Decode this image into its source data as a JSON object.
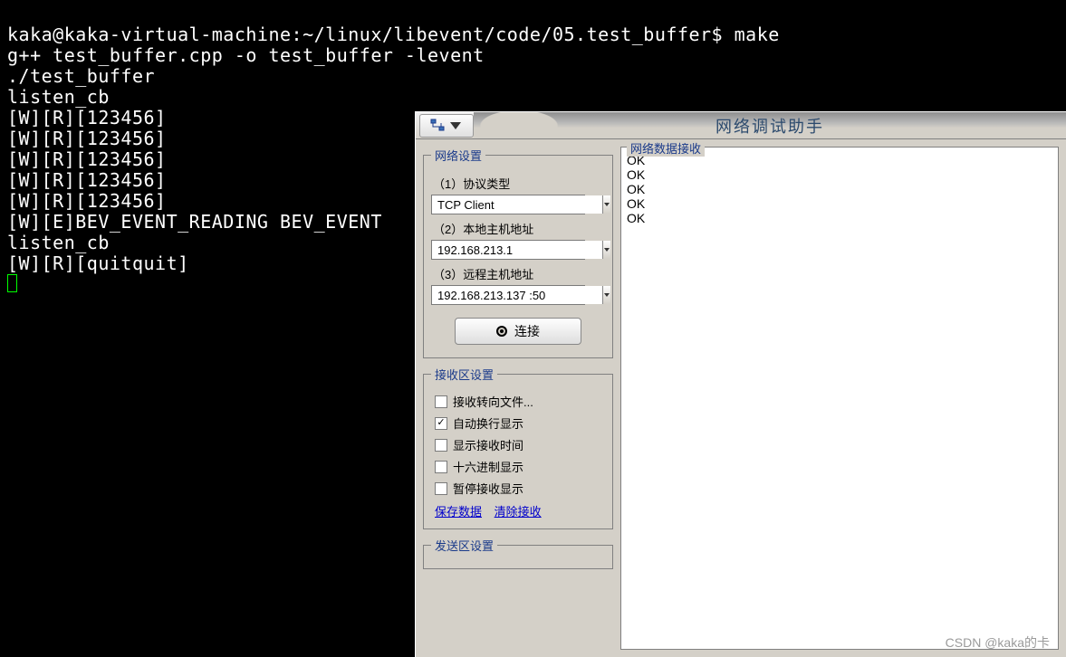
{
  "terminal": {
    "prompt": "kaka@kaka-virtual-machine:~/linux/libevent/code/05.test_buffer$ ",
    "cmd": "make",
    "lines": [
      "g++ test_buffer.cpp -o test_buffer -levent",
      "./test_buffer",
      "listen_cb",
      "[W][R][123456]",
      "[W][R][123456]",
      "[W][R][123456]",
      "[W][R][123456]",
      "[W][R][123456]",
      "[W][E]BEV_EVENT_READING BEV_EVENT",
      "listen_cb",
      "[W][R][quitquit]"
    ]
  },
  "app": {
    "title": "网络调试助手",
    "net_settings": {
      "legend": "网络设置",
      "proto_label": "（1）协议类型",
      "proto_value": "TCP Client",
      "local_label": "（2）本地主机地址",
      "local_value": "192.168.213.1",
      "remote_label": "（3）远程主机地址",
      "remote_value": "192.168.213.137 :50",
      "connect_label": "连接"
    },
    "recv_settings": {
      "legend": "接收区设置",
      "opts": {
        "to_file": {
          "label": "接收转向文件...",
          "checked": false
        },
        "auto_wrap": {
          "label": "自动换行显示",
          "checked": true
        },
        "show_time": {
          "label": "显示接收时间",
          "checked": false
        },
        "hex": {
          "label": "十六进制显示",
          "checked": false
        },
        "pause": {
          "label": "暂停接收显示",
          "checked": false
        }
      },
      "links": {
        "save": "保存数据",
        "clear": "清除接收"
      }
    },
    "send_settings": {
      "legend": "发送区设置"
    },
    "recv_panel": {
      "legend": "网络数据接收",
      "lines": [
        "OK",
        "OK",
        "OK",
        "OK",
        "OK"
      ]
    }
  },
  "watermark": "CSDN @kaka的卡"
}
